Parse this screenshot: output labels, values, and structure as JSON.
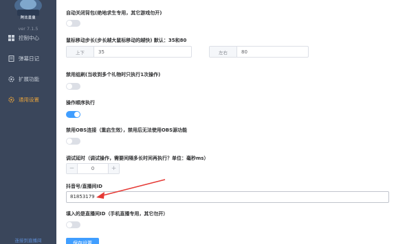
{
  "sidebar": {
    "logo_text": "阿比显皇",
    "version": "ver 7.1.5",
    "items": [
      {
        "label": "控制中心",
        "icon": "grid-icon"
      },
      {
        "label": "弹幕日记",
        "icon": "document-icon"
      },
      {
        "label": "扩展功能",
        "icon": "gear-icon"
      },
      {
        "label": "通用设置",
        "icon": "settings-icon"
      }
    ],
    "active_item": "通用设置",
    "bottom_link": "连接到直播间"
  },
  "settings": {
    "auto_close_backpack": {
      "label": "自动关闭背包(绝地求生专用，其它游戏勿开)",
      "enabled": false
    },
    "mouse_step": {
      "label": "鼠标移动步长(步长越大鼠标移动的越快) 默认：35和80",
      "updown_label": "上下",
      "updown_value": "35",
      "leftright_label": "左右",
      "leftright_value": "80"
    },
    "disable_combo": {
      "label": "禁用组刷(当收到多个礼物时只执行1次操作)",
      "enabled": false
    },
    "sequential": {
      "label": "操作顺序执行",
      "enabled": true
    },
    "disable_obs": {
      "label": "禁用OBS连接（重启生效），禁用后无法使用OBS源功能",
      "enabled": false
    },
    "debug_delay": {
      "label": "调试延时（调试操作，需要间隔多长时间再执行？单位：毫秒ms）",
      "minus": "−",
      "value": "0",
      "plus": "+"
    },
    "room_id": {
      "label": "抖音号/直播间ID",
      "value": "81853179"
    },
    "phone_room": {
      "label": "填入的是直播间ID（手机直播专用，其它勿开）",
      "enabled": false
    }
  },
  "save_button": "保存设置",
  "colors": {
    "sidebar_bg": "#3a465b",
    "active": "#e6a23c",
    "primary": "#409eff",
    "annotation": "#e53935"
  }
}
